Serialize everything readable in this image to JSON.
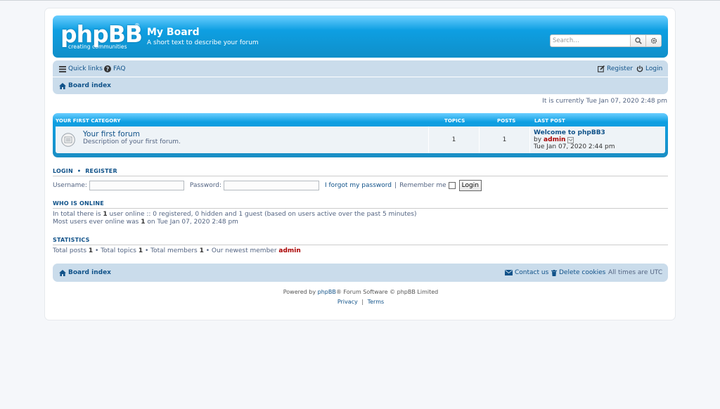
{
  "header": {
    "logo_word": "phpBB",
    "logo_reg": "®",
    "logo_tagline": "creating communities",
    "site_title": "My Board",
    "site_description": "A short text to describe your forum",
    "search_placeholder": "Search…"
  },
  "navbar": {
    "quick_links": "Quick links",
    "faq": "FAQ",
    "register": "Register",
    "login": "Login",
    "breadcrumb": "Board index"
  },
  "current_time": "It is currently Tue Jan 07, 2020 2:48 pm",
  "category": {
    "name": "YOUR FIRST CATEGORY",
    "col_topics": "TOPICS",
    "col_posts": "POSTS",
    "col_last_post": "LAST POST",
    "forum": {
      "name": "Your first forum",
      "description": "Description of your first forum.",
      "topics": "1",
      "posts": "1",
      "last_post_title": "Welcome to phpBB3",
      "last_post_by": "by",
      "last_post_author": "admin",
      "last_post_time": "Tue Jan 07, 2020 2:44 pm"
    }
  },
  "login_section": {
    "login": "LOGIN",
    "separator": "•",
    "register": "REGISTER",
    "username_label": "Username:",
    "password_label": "Password:",
    "forgot": "I forgot my password",
    "pipe": "|",
    "remember": "Remember me",
    "button": "Login"
  },
  "online": {
    "heading": "WHO IS ONLINE",
    "line1_pre": "In total there is",
    "line1_count": "1",
    "line1_post": "user online :: 0 registered, 0 hidden and 1 guest (based on users active over the past 5 minutes)",
    "line2_pre": "Most users ever online was",
    "line2_count": "1",
    "line2_post": "on Tue Jan 07, 2020 2:48 pm"
  },
  "stats": {
    "heading": "STATISTICS",
    "posts_label": "Total posts",
    "posts": "1",
    "topics_label": "• Total topics",
    "topics": "1",
    "members_label": "• Total members",
    "members": "1",
    "newest_label": "• Our newest member",
    "newest": "admin"
  },
  "footer_nav": {
    "breadcrumb": "Board index",
    "contact": "Contact us",
    "delete_cookies": "Delete cookies",
    "timezone": "All times are UTC"
  },
  "copyright": {
    "powered_by": "Powered by",
    "phpbb": "phpBB",
    "rest": "® Forum Software © phpBB Limited",
    "privacy": "Privacy",
    "pipe": "|",
    "terms": "Terms"
  },
  "colors": {
    "header_blue": "#108fc9",
    "navbar_bg": "#cadceb",
    "link": "#105289",
    "admin_red": "#aa0000"
  }
}
